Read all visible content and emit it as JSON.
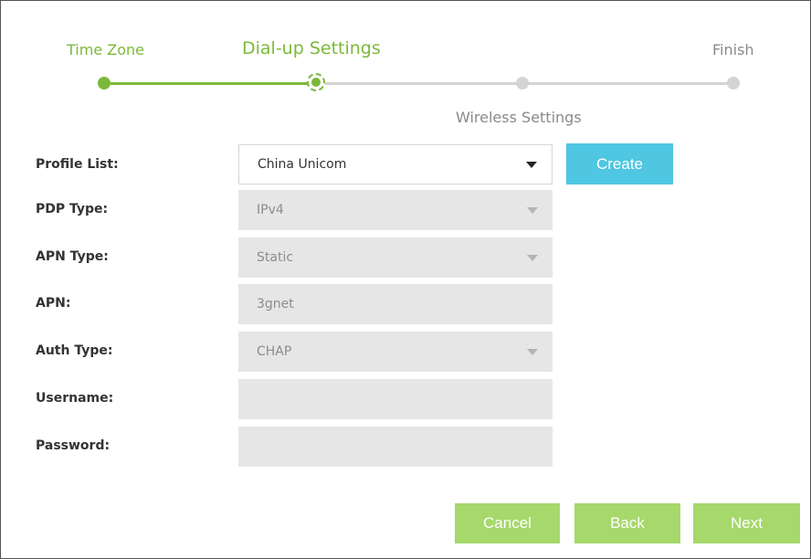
{
  "stepper": {
    "steps": [
      {
        "label": "Time Zone",
        "state": "done"
      },
      {
        "label": "Dial-up Settings",
        "state": "current"
      },
      {
        "label": "Wireless Settings",
        "state": "todo"
      },
      {
        "label": "Finish",
        "state": "todo"
      }
    ]
  },
  "form": {
    "profile_list": {
      "label": "Profile List:",
      "value": "China Unicom"
    },
    "pdp_type": {
      "label": "PDP Type:",
      "value": "IPv4"
    },
    "apn_type": {
      "label": "APN Type:",
      "value": "Static"
    },
    "apn": {
      "label": "APN:",
      "value": "3gnet"
    },
    "auth_type": {
      "label": "Auth Type:",
      "value": "CHAP"
    },
    "username": {
      "label": "Username:",
      "value": ""
    },
    "password": {
      "label": "Password:",
      "value": ""
    }
  },
  "buttons": {
    "create": "Create",
    "cancel": "Cancel",
    "back": "Back",
    "next": "Next"
  },
  "colors": {
    "accent_green": "#7bb93a",
    "button_green": "#a6d86b",
    "button_blue": "#4fc6e2",
    "inactive": "#d4d4d4"
  },
  "icons": {
    "dropdown": "triangle-down-icon"
  }
}
